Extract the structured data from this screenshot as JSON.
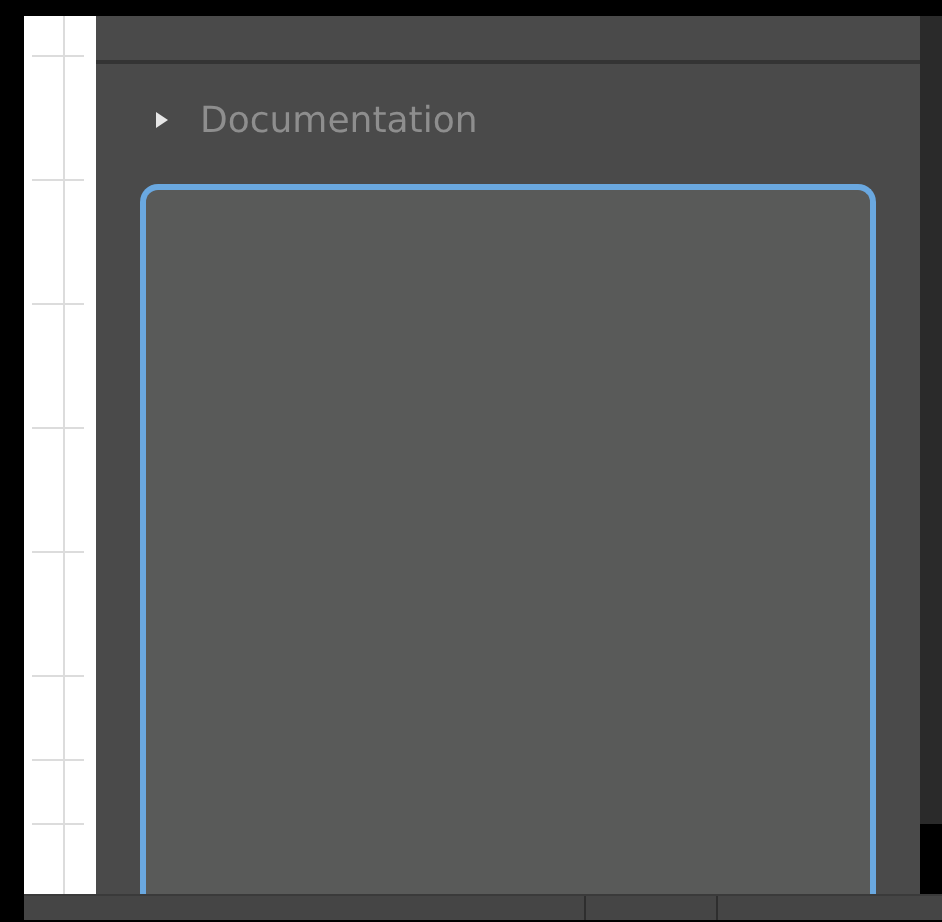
{
  "section": {
    "title": "Documentation",
    "expanded": false
  }
}
